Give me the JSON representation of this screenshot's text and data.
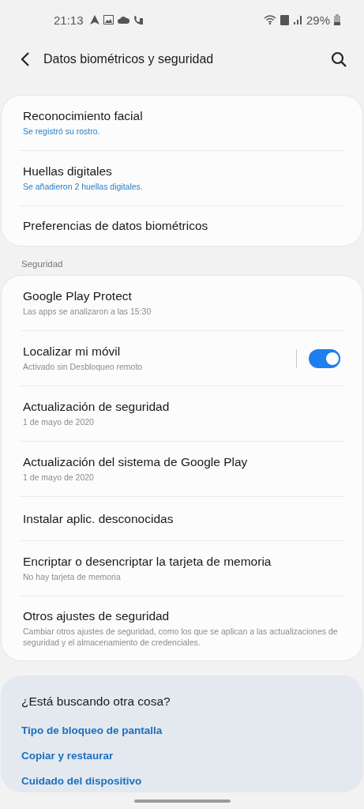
{
  "status_bar": {
    "time": "21:13",
    "battery": "29%"
  },
  "header": {
    "title": "Datos biométricos y seguridad"
  },
  "biometrics": [
    {
      "title": "Reconocimiento facial",
      "subtitle": "Se registró su rostro.",
      "accent": true
    },
    {
      "title": "Huellas digitales",
      "subtitle": "Se añadieron 2 huellas digitales.",
      "accent": true
    },
    {
      "title": "Preferencias de datos biométricos"
    }
  ],
  "security_section": {
    "label": "Seguridad"
  },
  "security": [
    {
      "kind": "item",
      "title": "Google Play Protect",
      "subtitle": "Las apps se analizaron a las 15:30"
    },
    {
      "kind": "toggle",
      "title": "Localizar mi móvil",
      "subtitle": "Activado sin Desbloqueo remoto",
      "on": true
    },
    {
      "kind": "item",
      "title": "Actualización de seguridad",
      "subtitle": "1 de mayo de 2020"
    },
    {
      "kind": "item",
      "title": "Actualización del sistema de Google Play",
      "subtitle": "1 de mayo de 2020"
    },
    {
      "kind": "item",
      "title": "Instalar aplic. desconocidas"
    },
    {
      "kind": "item",
      "title": "Encriptar o desencriptar la tarjeta de memoria",
      "subtitle": "No hay tarjeta de memoria"
    },
    {
      "kind": "item",
      "title": "Otros ajustes de seguridad",
      "subtitle": "Cambiar otros ajustes de seguridad, como los que se aplican a las actualizaciones de seguridad y el almacenamiento de credenciales."
    }
  ],
  "suggestions": {
    "heading": "¿Está buscando otra cosa?",
    "links": [
      "Tipo de bloqueo de pantalla",
      "Copiar y restaurar",
      "Cuidado del dispositivo"
    ]
  }
}
